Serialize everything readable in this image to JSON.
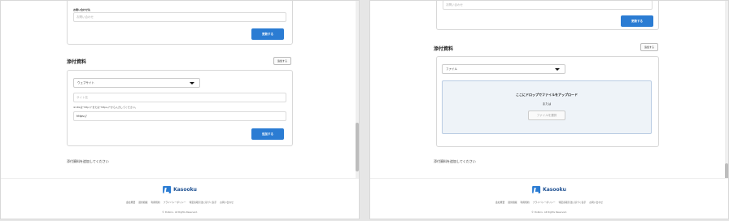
{
  "left": {
    "contact_label": "お問い合わせ先",
    "contact_placeholder": "お問い合わせ",
    "update_button": "更新する",
    "attachments_title": "添付資料",
    "add_button": "追加する",
    "type_select": "ウェブサイト",
    "site_name_placeholder": "サイト名",
    "url_hint": "※URLは\"http://\"または\"https://\"から入力してください。",
    "url_value": "https://",
    "register_button": "追加する",
    "empty_note": "添付資料を追加してください"
  },
  "right": {
    "contact_placeholder": "お問い合わせ",
    "update_button": "更新する",
    "attachments_title": "添付資料",
    "add_button": "追加する",
    "type_select": "ファイル",
    "drop_text": "ここにドロップでファイルをアップロード",
    "or_text": "または",
    "choose_file": "ファイルを選択",
    "empty_note": "添付資料を追加してください"
  },
  "footer": {
    "brand": "Kasooku",
    "links": [
      "会社概要",
      "運営組織",
      "利用規約",
      "プライバシーポリシー",
      "特定商取引法に基づく表示",
      "お問い合わせ"
    ],
    "copyright": "© DoKoru. All Rights Reserved."
  },
  "colors": {
    "primary": "#2b7cd3",
    "brand_text": "#1d4f91",
    "drop_bg": "#eef3f8"
  },
  "icons": {
    "dropdown": "caret-down-icon",
    "logo": "kasooku-logo-icon"
  }
}
